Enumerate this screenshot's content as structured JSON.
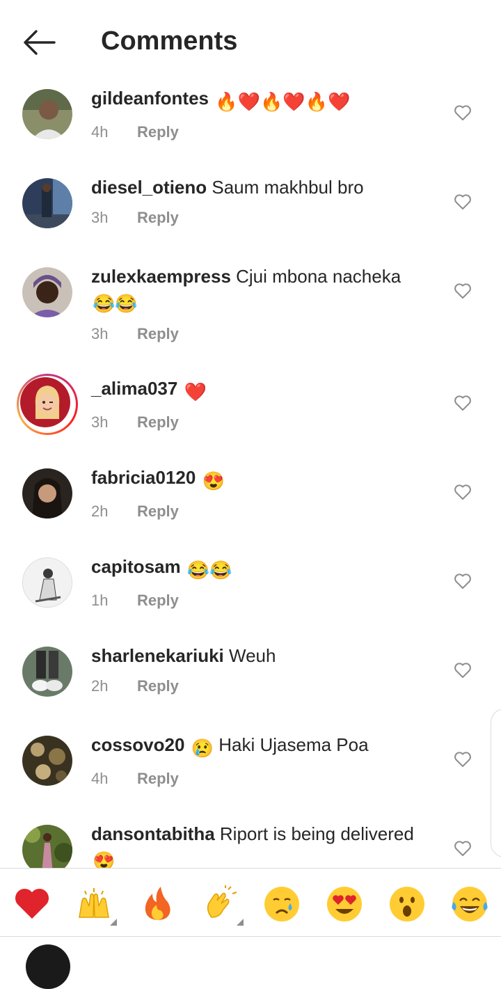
{
  "header": {
    "title": "Comments",
    "back_icon": "arrow-left-icon"
  },
  "reply_label": "Reply",
  "comments": [
    {
      "user": "gildeanfontes",
      "text": "",
      "emoji": "🔥❤️🔥❤️🔥❤️",
      "time": "4h"
    },
    {
      "user": "diesel_otieno",
      "text": " Saum makhbul bro",
      "emoji": "",
      "time": "3h"
    },
    {
      "user": "zulexkaempress",
      "text": " Cjui mbona nacheka",
      "emoji": "😂😂",
      "time": "3h"
    },
    {
      "user": "_alima037",
      "text": "",
      "emoji": "❤️",
      "time": "3h"
    },
    {
      "user": "fabricia0120",
      "text": "",
      "emoji": "😍",
      "time": "2h"
    },
    {
      "user": "capitosam",
      "text": "",
      "emoji": "😂😂",
      "time": "1h"
    },
    {
      "user": "sharlenekariuki",
      "text": " Weuh",
      "emoji": "",
      "time": "2h"
    },
    {
      "user": "cossovo20",
      "text": " Haki Ujasema Poa",
      "emoji": "😢",
      "time": "4h"
    },
    {
      "user": "dansontabitha",
      "text": " Riport is being delivered",
      "emoji": "😍",
      "time": ""
    }
  ],
  "reactions": [
    "❤️",
    "🙌",
    "🔥",
    "👏",
    "😢",
    "😍",
    "😮",
    "😂"
  ],
  "colors": {
    "text": "#262626",
    "muted": "#8e8e8e",
    "divider": "#dbdbdb",
    "heart_red": "#ed4956"
  }
}
